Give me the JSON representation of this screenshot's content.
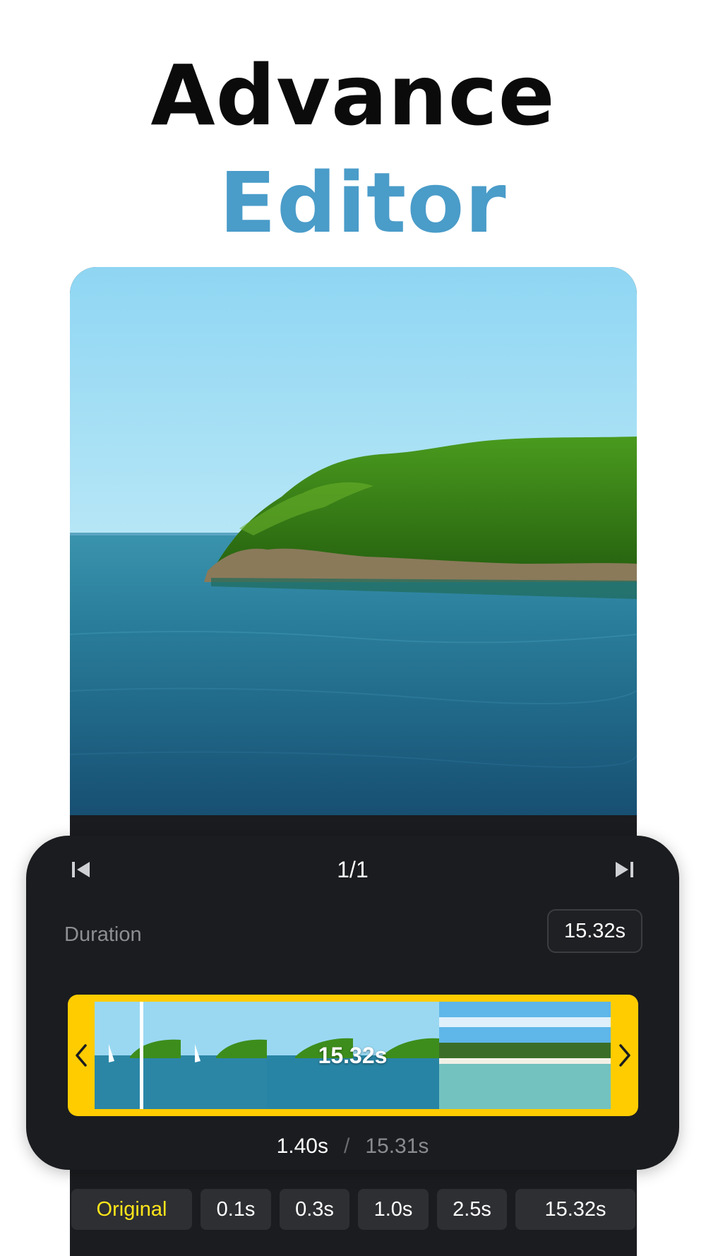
{
  "headline": {
    "line1": "Advance",
    "line2": "Editor"
  },
  "colors": {
    "accent_blue": "#4a9cc9",
    "timeline_yellow": "#ffcc00",
    "active_chip_text": "#ffe51a",
    "panel_dark": "#1b1c1f"
  },
  "player": {
    "prev_icon": "skip-previous-icon",
    "next_icon": "skip-next-icon",
    "counter": "1/1",
    "duration_label": "Duration",
    "duration_value": "15.32s"
  },
  "timeline": {
    "left_arrow_icon": "chevron-left-icon",
    "right_arrow_icon": "chevron-right-icon",
    "clip_duration": "15.32s",
    "playhead_position_s": 1.4
  },
  "time_readout": {
    "current": "1.40s",
    "separator": "/",
    "total": "15.31s"
  },
  "speed_options": [
    {
      "label": "Original",
      "active": true
    },
    {
      "label": "0.1s",
      "active": false
    },
    {
      "label": "0.3s",
      "active": false
    },
    {
      "label": "1.0s",
      "active": false
    },
    {
      "label": "2.5s",
      "active": false
    },
    {
      "label": "15.32s",
      "active": false
    }
  ]
}
